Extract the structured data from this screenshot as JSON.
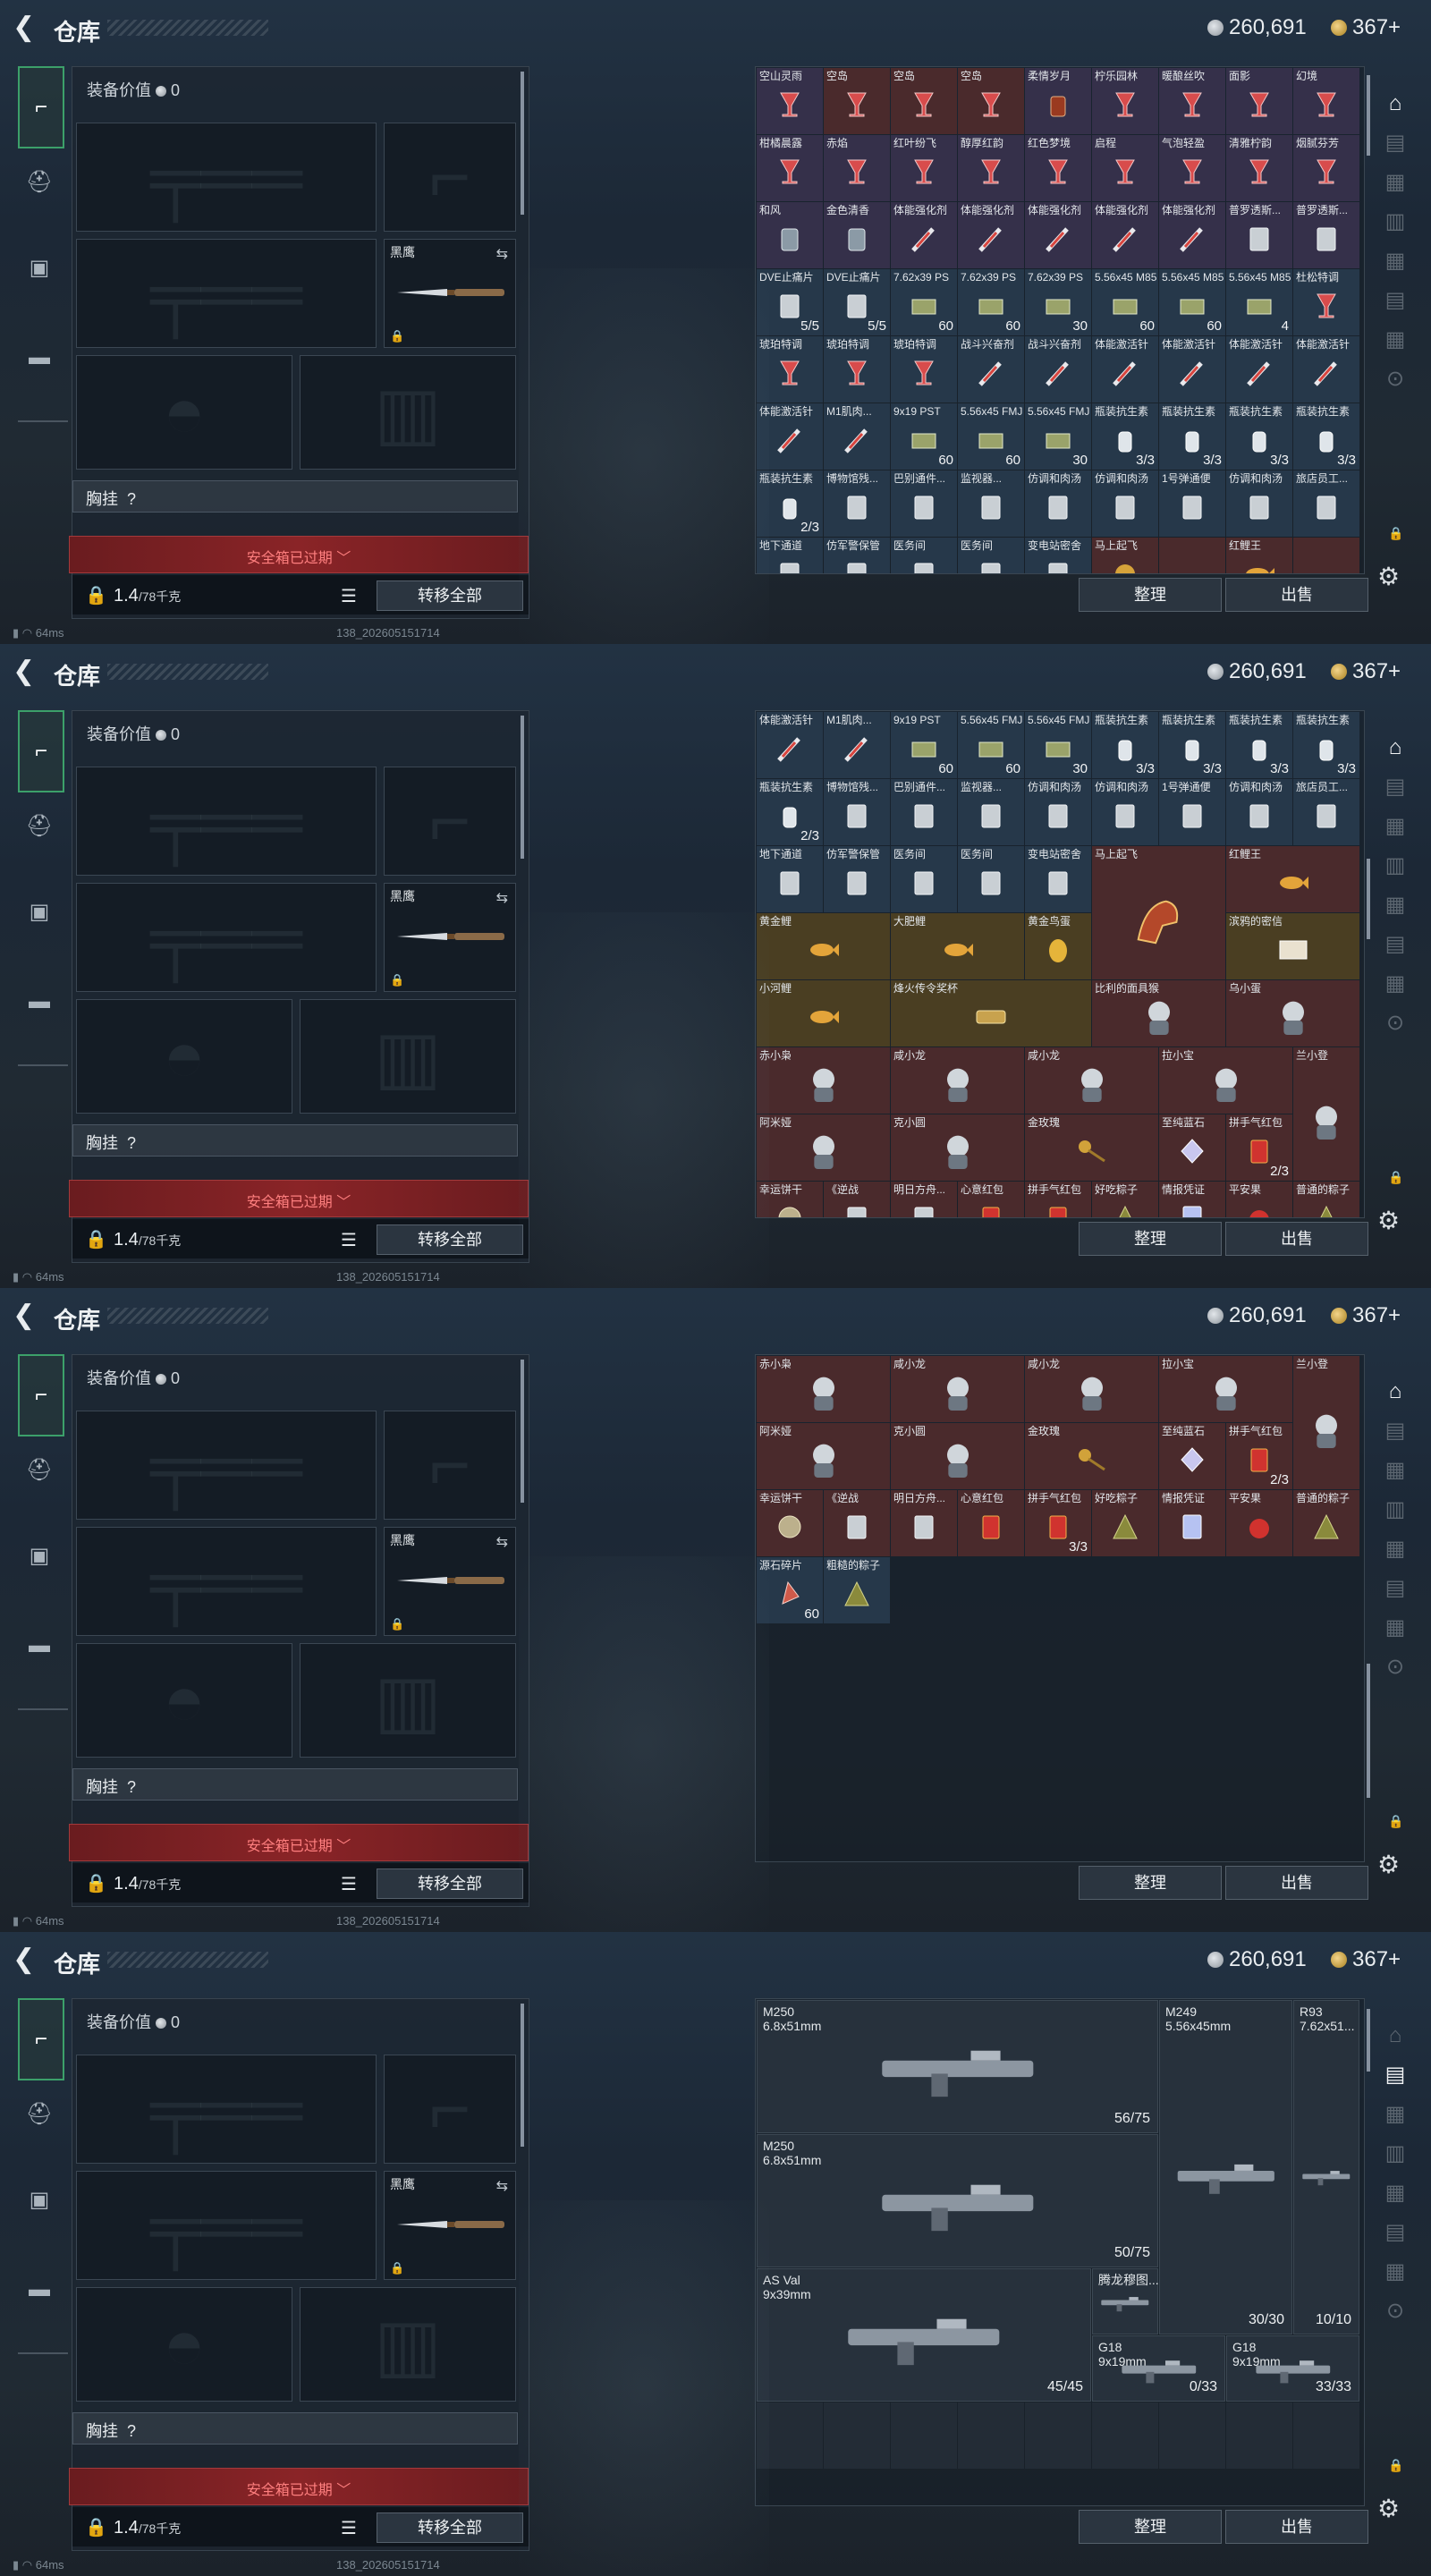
{
  "app": {
    "title": "仓库",
    "back_icon": "back-arrow-icon"
  },
  "currency": {
    "silver": "260,691",
    "gold": "367+"
  },
  "equipment": {
    "value_label": "装备价值",
    "value": "0",
    "melee_label": "黑鹰",
    "chest_label": "胸挂",
    "chest_value": "?",
    "safebox_expired": "安全箱已过期",
    "weight": "1.4",
    "weight_max": "/78千克",
    "transfer_all": "转移全部"
  },
  "actions": {
    "sort": "整理",
    "sell": "出售"
  },
  "status": {
    "ping": "64ms",
    "build": "138_202605151714"
  },
  "screen1_items": [
    {
      "name": "空山灵雨",
      "qty": "",
      "c": "c-purple",
      "i": "drink"
    },
    {
      "name": "空岛",
      "qty": "",
      "c": "c-red",
      "i": "drink"
    },
    {
      "name": "空岛",
      "qty": "",
      "c": "c-red",
      "i": "drink"
    },
    {
      "name": "空岛",
      "qty": "",
      "c": "c-red",
      "i": "drink"
    },
    {
      "name": "柔情岁月",
      "qty": "",
      "c": "c-purple",
      "i": "glass"
    },
    {
      "name": "柠乐园林",
      "qty": "",
      "c": "c-purple",
      "i": "drink"
    },
    {
      "name": "暖酿丝吹",
      "qty": "",
      "c": "c-purple",
      "i": "drink"
    },
    {
      "name": "面影",
      "qty": "",
      "c": "c-purple",
      "i": "drink"
    },
    {
      "name": "幻境",
      "qty": "",
      "c": "c-purple",
      "i": "drink"
    },
    {
      "name": "柑橘晨露",
      "qty": "",
      "c": "c-purple",
      "i": "drink"
    },
    {
      "name": "赤焰",
      "qty": "",
      "c": "c-purple",
      "i": "drink"
    },
    {
      "name": "红叶纷飞",
      "qty": "",
      "c": "c-purple",
      "i": "drink"
    },
    {
      "name": "醇厚红韵",
      "qty": "",
      "c": "c-purple",
      "i": "drink"
    },
    {
      "name": "红色梦境",
      "qty": "",
      "c": "c-purple",
      "i": "drink"
    },
    {
      "name": "启程",
      "qty": "",
      "c": "c-purple",
      "i": "drink"
    },
    {
      "name": "气泡轻盈",
      "qty": "",
      "c": "c-purple",
      "i": "drink"
    },
    {
      "name": "清雅柠韵",
      "qty": "",
      "c": "c-purple",
      "i": "drink"
    },
    {
      "name": "烟腻芬芳",
      "qty": "",
      "c": "c-purple",
      "i": "drink"
    },
    {
      "name": "和风",
      "qty": "",
      "c": "c-purple",
      "i": "jar"
    },
    {
      "name": "金色清香",
      "qty": "",
      "c": "c-purple",
      "i": "jar"
    },
    {
      "name": "体能强化剂",
      "qty": "",
      "c": "c-purple",
      "i": "syringe"
    },
    {
      "name": "体能强化剂",
      "qty": "",
      "c": "c-purple",
      "i": "syringe"
    },
    {
      "name": "体能强化剂",
      "qty": "",
      "c": "c-purple",
      "i": "syringe"
    },
    {
      "name": "体能强化剂",
      "qty": "",
      "c": "c-purple",
      "i": "syringe"
    },
    {
      "name": "体能强化剂",
      "qty": "",
      "c": "c-purple",
      "i": "syringe"
    },
    {
      "name": "普罗透斯...",
      "qty": "",
      "c": "c-purple",
      "i": "pack"
    },
    {
      "name": "普罗透斯...",
      "qty": "",
      "c": "c-purple",
      "i": "pack"
    },
    {
      "name": "DVE止痛片",
      "qty": "5/5",
      "c": "c-blue",
      "i": "pack"
    },
    {
      "name": "DVE止痛片",
      "qty": "5/5",
      "c": "c-blue",
      "i": "pack"
    },
    {
      "name": "7.62x39 PS",
      "qty": "60",
      "c": "c-blue",
      "i": "ammo"
    },
    {
      "name": "7.62x39 PS",
      "qty": "60",
      "c": "c-blue",
      "i": "ammo"
    },
    {
      "name": "7.62x39 PS",
      "qty": "30",
      "c": "c-blue",
      "i": "ammo"
    },
    {
      "name": "5.56x45 M855",
      "qty": "60",
      "c": "c-blue",
      "i": "ammo"
    },
    {
      "name": "5.56x45 M855",
      "qty": "60",
      "c": "c-blue",
      "i": "ammo"
    },
    {
      "name": "5.56x45 M855",
      "qty": "4",
      "c": "c-blue",
      "i": "ammo"
    },
    {
      "name": "杜松特调",
      "qty": "",
      "c": "c-blue",
      "i": "drink"
    },
    {
      "name": "琥珀特调",
      "qty": "",
      "c": "c-blue",
      "i": "drink"
    },
    {
      "name": "琥珀特调",
      "qty": "",
      "c": "c-blue",
      "i": "drink"
    },
    {
      "name": "琥珀特调",
      "qty": "",
      "c": "c-blue",
      "i": "drink"
    },
    {
      "name": "战斗兴奋剂",
      "qty": "",
      "c": "c-blue",
      "i": "syringe"
    },
    {
      "name": "战斗兴奋剂",
      "qty": "",
      "c": "c-blue",
      "i": "syringe"
    },
    {
      "name": "体能激活针",
      "qty": "",
      "c": "c-blue",
      "i": "syringe"
    },
    {
      "name": "体能激活针",
      "qty": "",
      "c": "c-blue",
      "i": "syringe"
    },
    {
      "name": "体能激活针",
      "qty": "",
      "c": "c-blue",
      "i": "syringe"
    },
    {
      "name": "体能激活针",
      "qty": "",
      "c": "c-blue",
      "i": "syringe"
    },
    {
      "name": "体能激活针",
      "qty": "",
      "c": "c-blue",
      "i": "syringe"
    },
    {
      "name": "M1肌肉...",
      "qty": "",
      "c": "c-blue",
      "i": "syringe"
    },
    {
      "name": "9x19 PST",
      "qty": "60",
      "c": "c-blue",
      "i": "ammo"
    },
    {
      "name": "5.56x45 FMJ",
      "qty": "60",
      "c": "c-blue",
      "i": "ammo"
    },
    {
      "name": "5.56x45 FMJ",
      "qty": "30",
      "c": "c-blue",
      "i": "ammo"
    },
    {
      "name": "瓶装抗生素",
      "qty": "3/3",
      "c": "c-blue",
      "i": "bottle"
    },
    {
      "name": "瓶装抗生素",
      "qty": "3/3",
      "c": "c-blue",
      "i": "bottle"
    },
    {
      "name": "瓶装抗生素",
      "qty": "3/3",
      "c": "c-blue",
      "i": "bottle"
    },
    {
      "name": "瓶装抗生素",
      "qty": "3/3",
      "c": "c-blue",
      "i": "bottle"
    },
    {
      "name": "瓶装抗生素",
      "qty": "2/3",
      "c": "c-blue",
      "i": "bottle"
    },
    {
      "name": "博物馆残...",
      "qty": "",
      "c": "c-blue",
      "i": "pack"
    },
    {
      "name": "巴别通件...",
      "qty": "",
      "c": "c-blue",
      "i": "pack"
    },
    {
      "name": "监视器...",
      "qty": "",
      "c": "c-blue",
      "i": "pack"
    },
    {
      "name": "仿调和肉汤",
      "qty": "",
      "c": "c-blue",
      "i": "pack"
    },
    {
      "name": "仿调和肉汤",
      "qty": "",
      "c": "c-blue",
      "i": "pack"
    },
    {
      "name": "1号弹通便",
      "qty": "",
      "c": "c-blue",
      "i": "pack"
    },
    {
      "name": "仿调和肉汤",
      "qty": "",
      "c": "c-blue",
      "i": "pack"
    },
    {
      "name": "旅店员工...",
      "qty": "",
      "c": "c-blue",
      "i": "pack"
    },
    {
      "name": "地下通道",
      "qty": "",
      "c": "c-blue",
      "i": "pack"
    },
    {
      "name": "仿军警保管",
      "qty": "",
      "c": "c-blue",
      "i": "pack"
    },
    {
      "name": "医务间",
      "qty": "",
      "c": "c-blue",
      "i": "pack"
    },
    {
      "name": "医务间",
      "qty": "",
      "c": "c-blue",
      "i": "pack"
    },
    {
      "name": "变电站密舍",
      "qty": "",
      "c": "c-blue",
      "i": "pack"
    },
    {
      "name": "马上起飞",
      "qty": "",
      "c": "c-red",
      "i": "gold"
    },
    {
      "name": "",
      "qty": "",
      "c": "c-red",
      "i": ""
    },
    {
      "name": "红鲤王",
      "qty": "",
      "c": "c-red",
      "i": "fish"
    },
    {
      "name": "",
      "qty": "",
      "c": "c-red",
      "i": ""
    }
  ],
  "screen2_items": [
    {
      "name": "体能激活针",
      "qty": "",
      "c": "c-blue",
      "i": "syringe"
    },
    {
      "name": "M1肌肉...",
      "qty": "",
      "c": "c-blue",
      "i": "syringe"
    },
    {
      "name": "9x19 PST",
      "qty": "60",
      "c": "c-blue",
      "i": "ammo"
    },
    {
      "name": "5.56x45 FMJ",
      "qty": "60",
      "c": "c-blue",
      "i": "ammo"
    },
    {
      "name": "5.56x45 FMJ",
      "qty": "30",
      "c": "c-blue",
      "i": "ammo"
    },
    {
      "name": "瓶装抗生素",
      "qty": "3/3",
      "c": "c-blue",
      "i": "bottle"
    },
    {
      "name": "瓶装抗生素",
      "qty": "3/3",
      "c": "c-blue",
      "i": "bottle"
    },
    {
      "name": "瓶装抗生素",
      "qty": "3/3",
      "c": "c-blue",
      "i": "bottle"
    },
    {
      "name": "瓶装抗生素",
      "qty": "3/3",
      "c": "c-blue",
      "i": "bottle"
    },
    {
      "name": "瓶装抗生素",
      "qty": "2/3",
      "c": "c-blue",
      "i": "bottle"
    },
    {
      "name": "博物馆残...",
      "qty": "",
      "c": "c-blue",
      "i": "pack"
    },
    {
      "name": "巴别通件...",
      "qty": "",
      "c": "c-blue",
      "i": "pack"
    },
    {
      "name": "监视器...",
      "qty": "",
      "c": "c-blue",
      "i": "pack"
    },
    {
      "name": "仿调和肉汤",
      "qty": "",
      "c": "c-blue",
      "i": "pack"
    },
    {
      "name": "仿调和肉汤",
      "qty": "",
      "c": "c-blue",
      "i": "pack"
    },
    {
      "name": "1号弹通便",
      "qty": "",
      "c": "c-blue",
      "i": "pack"
    },
    {
      "name": "仿调和肉汤",
      "qty": "",
      "c": "c-blue",
      "i": "pack"
    },
    {
      "name": "旅店员工...",
      "qty": "",
      "c": "c-blue",
      "i": "pack"
    },
    {
      "name": "地下通道",
      "qty": "",
      "c": "c-blue",
      "i": "pack"
    },
    {
      "name": "仿军警保管",
      "qty": "",
      "c": "c-blue",
      "i": "pack"
    },
    {
      "name": "医务间",
      "qty": "",
      "c": "c-blue",
      "i": "pack"
    },
    {
      "name": "医务间",
      "qty": "",
      "c": "c-blue",
      "i": "pack"
    },
    {
      "name": "变电站密舍",
      "qty": "",
      "c": "c-blue",
      "i": "pack"
    },
    {
      "name": "马上起飞",
      "qty": "",
      "c": "c-red",
      "i": "horse",
      "w": 2,
      "h": 2
    },
    {
      "name": "红鲤王",
      "qty": "",
      "c": "c-red",
      "i": "fish",
      "w": 2
    },
    {
      "name": "黄金鲤",
      "qty": "",
      "c": "c-gold",
      "i": "fish",
      "w": 2
    },
    {
      "name": "大肥鲤",
      "qty": "",
      "c": "c-gold",
      "i": "fish",
      "w": 2
    },
    {
      "name": "黄金鸟蛋",
      "qty": "",
      "c": "c-gold",
      "i": "egg"
    },
    {
      "name": "滨鸦的密信",
      "qty": "",
      "c": "c-gold",
      "i": "letter",
      "w": 2
    },
    {
      "name": "小河鲤",
      "qty": "",
      "c": "c-gold",
      "i": "fish",
      "w": 2
    },
    {
      "name": "烽火传令奖杯",
      "qty": "",
      "c": "c-gold",
      "i": "trophy",
      "w": 3
    },
    {
      "name": "比利的面具猴",
      "qty": "",
      "c": "c-red",
      "i": "toy",
      "w": 2
    },
    {
      "name": "乌小蛋",
      "qty": "",
      "c": "c-red",
      "i": "toy",
      "w": 2
    },
    {
      "name": "赤小枭",
      "qty": "",
      "c": "c-red",
      "i": "toy",
      "w": 2
    },
    {
      "name": "咸小龙",
      "qty": "",
      "c": "c-red",
      "i": "toy",
      "w": 2
    },
    {
      "name": "咸小龙",
      "qty": "",
      "c": "c-red",
      "i": "toy",
      "w": 2
    },
    {
      "name": "拉小宝",
      "qty": "",
      "c": "c-red",
      "i": "toy",
      "w": 2
    },
    {
      "name": "兰小登",
      "qty": "",
      "c": "c-red",
      "i": "toy",
      "h": 2
    },
    {
      "name": "阿米娅",
      "qty": "",
      "c": "c-red",
      "i": "toy",
      "w": 2
    },
    {
      "name": "克小圆",
      "qty": "",
      "c": "c-red",
      "i": "toy",
      "w": 2
    },
    {
      "name": "金玫瑰",
      "qty": "",
      "c": "c-red",
      "i": "rose",
      "w": 2
    },
    {
      "name": "至纯蓝石",
      "qty": "",
      "c": "c-red",
      "i": "gem"
    },
    {
      "name": "拼手气红包",
      "qty": "2/3",
      "c": "c-red",
      "i": "envelope"
    },
    {
      "name": "幸运饼干",
      "qty": "",
      "c": "c-red",
      "i": "coin"
    },
    {
      "name": "《逆战",
      "qty": "",
      "c": "c-red",
      "i": "pack"
    },
    {
      "name": "明日方舟...",
      "qty": "",
      "c": "c-red",
      "i": "pack"
    },
    {
      "name": "心意红包",
      "qty": "",
      "c": "c-red",
      "i": "envelope"
    },
    {
      "name": "拼手气红包",
      "qty": "",
      "c": "c-red",
      "i": "envelope"
    },
    {
      "name": "好吃粽子",
      "qty": "",
      "c": "c-red",
      "i": "rice"
    },
    {
      "name": "情报凭证",
      "qty": "",
      "c": "c-red",
      "i": "card"
    },
    {
      "name": "平安果",
      "qty": "",
      "c": "c-red",
      "i": "apple"
    },
    {
      "name": "普通的粽子",
      "qty": "",
      "c": "c-red",
      "i": "rice"
    }
  ],
  "screen3_items": [
    {
      "name": "赤小枭",
      "qty": "",
      "c": "c-red",
      "i": "toy",
      "w": 2
    },
    {
      "name": "咸小龙",
      "qty": "",
      "c": "c-red",
      "i": "toy",
      "w": 2
    },
    {
      "name": "咸小龙",
      "qty": "",
      "c": "c-red",
      "i": "toy",
      "w": 2
    },
    {
      "name": "拉小宝",
      "qty": "",
      "c": "c-red",
      "i": "toy",
      "w": 2
    },
    {
      "name": "兰小登",
      "qty": "",
      "c": "c-red",
      "i": "toy",
      "h": 2
    },
    {
      "name": "阿米娅",
      "qty": "",
      "c": "c-red",
      "i": "toy",
      "w": 2
    },
    {
      "name": "克小圆",
      "qty": "",
      "c": "c-red",
      "i": "toy",
      "w": 2
    },
    {
      "name": "金玫瑰",
      "qty": "",
      "c": "c-red",
      "i": "rose",
      "w": 2
    },
    {
      "name": "至纯蓝石",
      "qty": "",
      "c": "c-red",
      "i": "gem"
    },
    {
      "name": "拼手气红包",
      "qty": "2/3",
      "c": "c-red",
      "i": "envelope"
    },
    {
      "name": "幸运饼干",
      "qty": "",
      "c": "c-red",
      "i": "coin"
    },
    {
      "name": "《逆战",
      "qty": "",
      "c": "c-red",
      "i": "pack"
    },
    {
      "name": "明日方舟...",
      "qty": "",
      "c": "c-red",
      "i": "pack"
    },
    {
      "name": "心意红包",
      "qty": "",
      "c": "c-red",
      "i": "envelope"
    },
    {
      "name": "拼手气红包",
      "qty": "3/3",
      "c": "c-red",
      "i": "envelope"
    },
    {
      "name": "好吃粽子",
      "qty": "",
      "c": "c-red",
      "i": "rice"
    },
    {
      "name": "情报凭证",
      "qty": "",
      "c": "c-red",
      "i": "card"
    },
    {
      "name": "平安果",
      "qty": "",
      "c": "c-red",
      "i": "apple"
    },
    {
      "name": "普通的粽子",
      "qty": "",
      "c": "c-red",
      "i": "rice"
    },
    {
      "name": "源石碎片",
      "qty": "60",
      "c": "c-blue",
      "i": "shard"
    },
    {
      "name": "粗糙的粽子",
      "qty": "",
      "c": "c-blue",
      "i": "rice"
    }
  ],
  "screen4_weapons": [
    {
      "name": "M250\n6.8x51mm",
      "ammo": "56/75",
      "x": 0,
      "y": 0,
      "w": 6,
      "h": 2
    },
    {
      "name": "M249\n5.56x45mm",
      "ammo": "30/30",
      "x": 6,
      "y": 0,
      "w": 2,
      "h": 5
    },
    {
      "name": "R93\n7.62x51...",
      "ammo": "10/10",
      "x": 8,
      "y": 0,
      "w": 1,
      "h": 5
    },
    {
      "name": "M250\n6.8x51mm",
      "ammo": "50/75",
      "x": 0,
      "y": 2,
      "w": 6,
      "h": 2
    },
    {
      "name": "AS Val\n9x39mm",
      "ammo": "45/45",
      "x": 0,
      "y": 4,
      "w": 5,
      "h": 2
    },
    {
      "name": "腾龙穆图...",
      "ammo": "",
      "x": 5,
      "y": 4,
      "w": 1,
      "h": 1
    },
    {
      "name": "G18\n9x19mm",
      "ammo": "0/33",
      "x": 5,
      "y": 5,
      "w": 2,
      "h": 1
    },
    {
      "name": "G18\n9x19mm",
      "ammo": "33/33",
      "x": 7,
      "y": 5,
      "w": 2,
      "h": 1
    }
  ]
}
